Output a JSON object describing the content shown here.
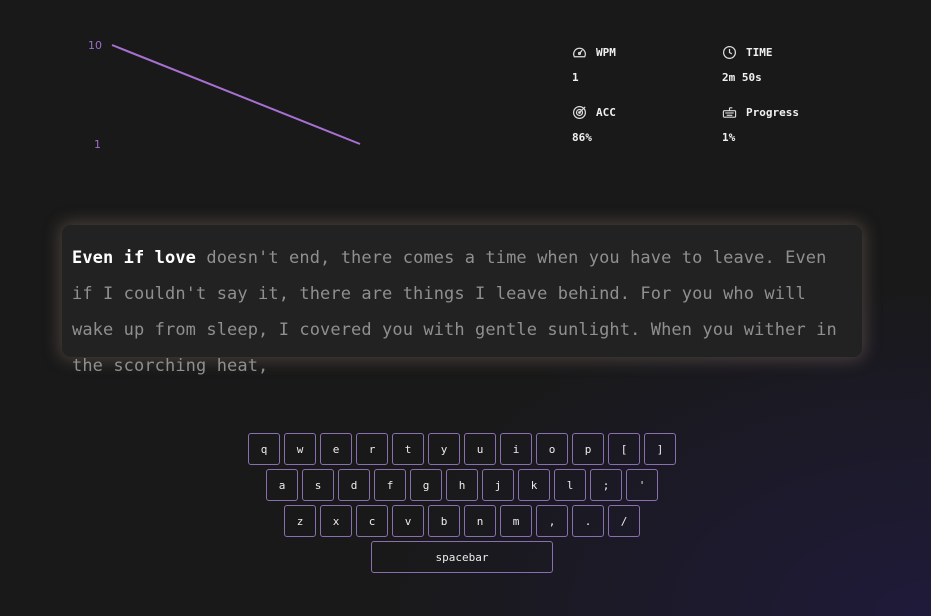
{
  "chart_data": {
    "type": "line",
    "y_ticks": [
      "10",
      "1"
    ],
    "series": [
      {
        "values": [
          10,
          1
        ]
      }
    ],
    "ylim": [
      1,
      10
    ],
    "color": "#a970d4"
  },
  "stats": {
    "wpm": {
      "label": "WPM",
      "value": "1",
      "icon": "gauge-icon"
    },
    "time": {
      "label": "TIME",
      "value": "2m 50s",
      "icon": "clock-icon"
    },
    "acc": {
      "label": "ACC",
      "value": "86%",
      "icon": "target-icon"
    },
    "progress": {
      "label": "Progress",
      "value": "1%",
      "icon": "keyboard-icon"
    }
  },
  "passage": {
    "typed": "Even if love",
    "remaining": " doesn't end, there comes a time when you have to leave. Even if I couldn't say it, there are things I leave behind. For you who will wake up from sleep, I covered you with gentle sunlight. When you wither in the scorching heat,"
  },
  "keyboard": {
    "rows": [
      [
        "q",
        "w",
        "e",
        "r",
        "t",
        "y",
        "u",
        "i",
        "o",
        "p",
        "[",
        "]"
      ],
      [
        "a",
        "s",
        "d",
        "f",
        "g",
        "h",
        "j",
        "k",
        "l",
        ";",
        "'"
      ],
      [
        "z",
        "x",
        "c",
        "v",
        "b",
        "n",
        "m",
        ",",
        ".",
        "/"
      ]
    ],
    "spacebar": "spacebar"
  }
}
